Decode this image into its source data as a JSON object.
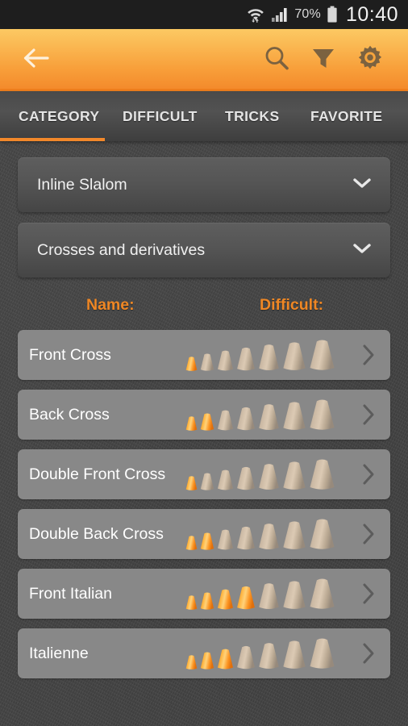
{
  "statusbar": {
    "wifi_icon": "wifi-icon",
    "signal_icon": "cell-signal-icon",
    "battery_percent": "70%",
    "battery_icon": "battery-icon",
    "clock": "10:40"
  },
  "actionbar": {
    "back_icon": "back-arrow-icon",
    "search_icon": "search-icon",
    "filter_icon": "filter-icon",
    "settings_icon": "gear-icon"
  },
  "tabs": {
    "items": [
      {
        "label": "CATEGORY",
        "active": true
      },
      {
        "label": "DIFFICULT",
        "active": false
      },
      {
        "label": "TRICKS",
        "active": false
      },
      {
        "label": "FAVORITE",
        "active": false
      }
    ],
    "indicator_color": "#f2882a"
  },
  "filters": {
    "discipline": {
      "value": "Inline Slalom",
      "chevron_icon": "chevron-down-icon"
    },
    "family": {
      "value": "Crosses and derivatives",
      "chevron_icon": "chevron-down-icon"
    }
  },
  "columns": {
    "name": "Name:",
    "difficult": "Difficult:"
  },
  "colors": {
    "accent_orange": "#ef8724",
    "accent_orange_dark": "#f07f1e",
    "row_bg": "#888888",
    "page_bg": "#454545",
    "cone_active": "#ff9a1a",
    "cone_inactive": "#c9ad92"
  },
  "list": {
    "max_difficulty": 7,
    "rows": [
      {
        "name": "Front Cross",
        "difficulty": 1,
        "chevron_icon": "chevron-right-icon"
      },
      {
        "name": "Back Cross",
        "difficulty": 2,
        "chevron_icon": "chevron-right-icon"
      },
      {
        "name": "Double Front Cross",
        "difficulty": 1,
        "chevron_icon": "chevron-right-icon"
      },
      {
        "name": "Double Back Cross",
        "difficulty": 2,
        "chevron_icon": "chevron-right-icon"
      },
      {
        "name": "Front Italian",
        "difficulty": 4,
        "chevron_icon": "chevron-right-icon"
      },
      {
        "name": "Italienne",
        "difficulty": 3,
        "chevron_icon": "chevron-right-icon"
      }
    ]
  }
}
